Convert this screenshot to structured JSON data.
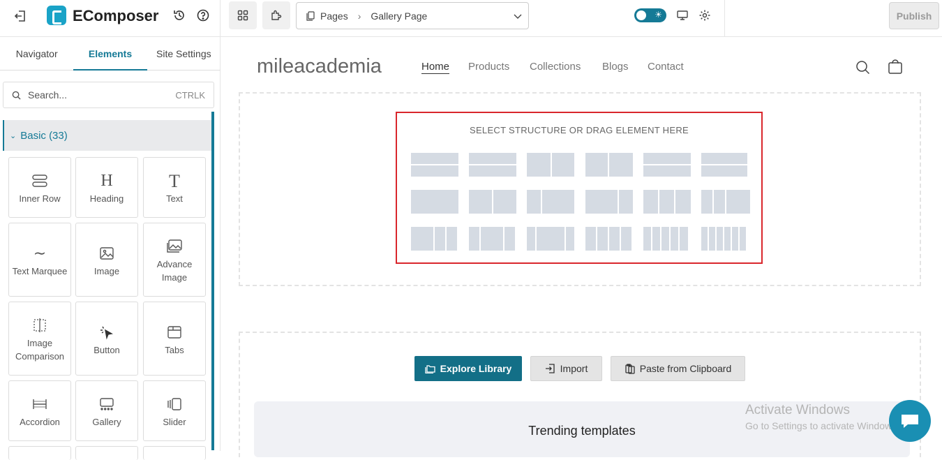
{
  "app": {
    "name": "EComposer"
  },
  "toolbar": {
    "breadcrumb_pages": "Pages",
    "breadcrumb_page": "Gallery Page",
    "publish_label": "Publish"
  },
  "sidebar": {
    "tabs": [
      "Navigator",
      "Elements",
      "Site Settings"
    ],
    "active_tab": "Elements",
    "search_placeholder": "Search...",
    "search_shortcut": "CTRLK",
    "category": "Basic (33)",
    "elements": [
      {
        "label": "Inner Row",
        "icon": "inner-row-icon"
      },
      {
        "label": "Heading",
        "icon": "heading-icon"
      },
      {
        "label": "Text",
        "icon": "text-icon"
      },
      {
        "label": "Text Marquee",
        "icon": "marquee-icon"
      },
      {
        "label": "Image",
        "icon": "image-icon"
      },
      {
        "label": "Advance Image",
        "icon": "advance-image-icon"
      },
      {
        "label": "Image Comparison",
        "icon": "image-comparison-icon"
      },
      {
        "label": "Button",
        "icon": "button-icon"
      },
      {
        "label": "Tabs",
        "icon": "tabs-icon"
      },
      {
        "label": "Accordion",
        "icon": "accordion-icon"
      },
      {
        "label": "Gallery",
        "icon": "gallery-icon"
      },
      {
        "label": "Slider",
        "icon": "slider-icon"
      }
    ]
  },
  "store": {
    "logo": "mileacademia",
    "nav": [
      "Home",
      "Products",
      "Collections",
      "Blogs",
      "Contact"
    ],
    "active_nav": "Home"
  },
  "structure": {
    "title": "SELECT STRUCTURE OR DRAG ELEMENT HERE"
  },
  "actions": {
    "explore": "Explore Library",
    "import": "Import",
    "paste": "Paste from Clipboard"
  },
  "trending": {
    "title": "Trending templates"
  },
  "watermark": {
    "line1": "Activate Windows",
    "line2": "Go to Settings to activate Windows."
  },
  "colors": {
    "accent": "#157a96",
    "highlight": "#d9262c"
  }
}
